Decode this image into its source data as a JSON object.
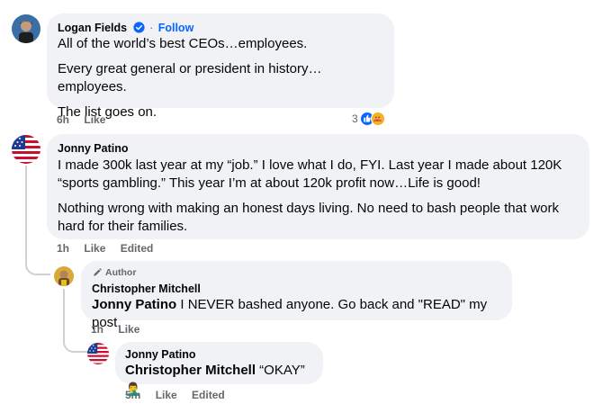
{
  "comments": [
    {
      "author": "Logan Fields",
      "follow_label": "Follow",
      "follow_sep": "·",
      "paragraphs": [
        "All of the world’s best CEOs…employees.",
        "Every great general or president in history…employees.",
        "The list goes on."
      ],
      "time": "6h",
      "like_label": "Like",
      "reaction_count": "3"
    },
    {
      "author": "Jonny Patino",
      "paragraphs": [
        "I made 300k last year at my “job.” I love what I do, FYI. Last year I made about 120K “sports gambling.” This year I’m at about 120k profit now…Life is good!",
        "Nothing wrong with making an honest days living. No need to bash people that work hard for their families."
      ],
      "time": "1h",
      "like_label": "Like",
      "edited_label": "Edited"
    }
  ],
  "replies": [
    {
      "badge": "Author",
      "author": "Christopher Mitchell",
      "mention": "Jonny Patino",
      "text": " I NEVER bashed anyone. Go back and \"READ\" my post.",
      "time": "1h",
      "like_label": "Like"
    },
    {
      "author": "Jonny Patino",
      "mention": "Christopher Mitchell",
      "text": " “OKAY” ",
      "emoji": "🤦‍♂️",
      "time": "5m",
      "like_label": "Like",
      "edited_label": "Edited"
    }
  ],
  "colors": {
    "bubble": "#f0f2f5",
    "meta_text": "#65676b",
    "link_blue": "#0866ff"
  },
  "icons": {
    "verified": "verified-badge-icon",
    "author_badge": "pencil-icon",
    "like_reaction": "like-reaction-icon",
    "care_reaction": "care-reaction-icon"
  }
}
